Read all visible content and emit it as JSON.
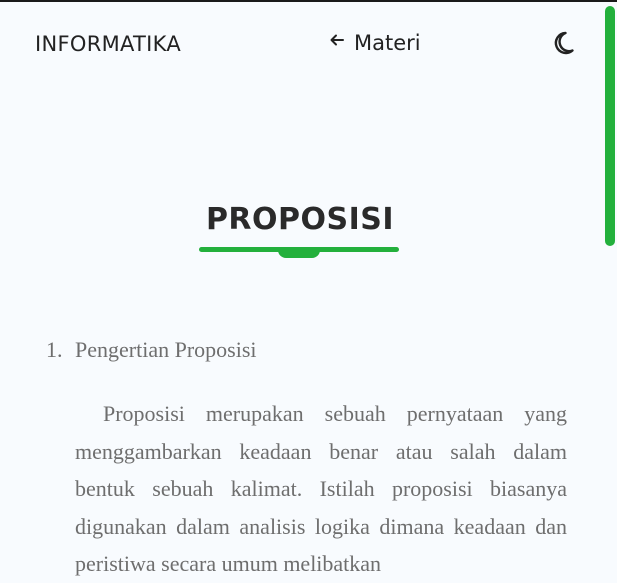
{
  "header": {
    "brand": "INFORMATIKA",
    "back_label": "Materi",
    "back_icon": "arrow-left-icon",
    "theme_icon": "moon-icon"
  },
  "page": {
    "title": "PROPOSISI"
  },
  "sections": [
    {
      "number": "1.",
      "heading": "Pengertian Proposisi",
      "paragraph": "Proposisi merupakan sebuah pernyataan yang menggambarkan keadaan benar atau salah dalam bentuk sebuah kalimat. Istilah proposisi biasanya digunakan dalam analisis logika dimana keadaan dan peristiwa secara umum melibatkan"
    }
  ],
  "colors": {
    "accent": "#23b03c",
    "background": "#f8fbfe",
    "text": "#222222",
    "body_text": "#6e6e6e"
  }
}
